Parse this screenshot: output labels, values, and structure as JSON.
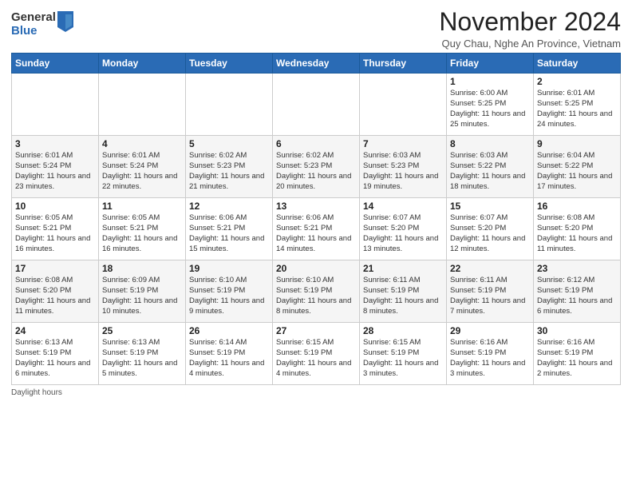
{
  "logo": {
    "general": "General",
    "blue": "Blue"
  },
  "title": "November 2024",
  "location": "Quy Chau, Nghe An Province, Vietnam",
  "days_of_week": [
    "Sunday",
    "Monday",
    "Tuesday",
    "Wednesday",
    "Thursday",
    "Friday",
    "Saturday"
  ],
  "weeks": [
    [
      {
        "day": "",
        "info": ""
      },
      {
        "day": "",
        "info": ""
      },
      {
        "day": "",
        "info": ""
      },
      {
        "day": "",
        "info": ""
      },
      {
        "day": "",
        "info": ""
      },
      {
        "day": "1",
        "info": "Sunrise: 6:00 AM\nSunset: 5:25 PM\nDaylight: 11 hours and 25 minutes."
      },
      {
        "day": "2",
        "info": "Sunrise: 6:01 AM\nSunset: 5:25 PM\nDaylight: 11 hours and 24 minutes."
      }
    ],
    [
      {
        "day": "3",
        "info": "Sunrise: 6:01 AM\nSunset: 5:24 PM\nDaylight: 11 hours and 23 minutes."
      },
      {
        "day": "4",
        "info": "Sunrise: 6:01 AM\nSunset: 5:24 PM\nDaylight: 11 hours and 22 minutes."
      },
      {
        "day": "5",
        "info": "Sunrise: 6:02 AM\nSunset: 5:23 PM\nDaylight: 11 hours and 21 minutes."
      },
      {
        "day": "6",
        "info": "Sunrise: 6:02 AM\nSunset: 5:23 PM\nDaylight: 11 hours and 20 minutes."
      },
      {
        "day": "7",
        "info": "Sunrise: 6:03 AM\nSunset: 5:23 PM\nDaylight: 11 hours and 19 minutes."
      },
      {
        "day": "8",
        "info": "Sunrise: 6:03 AM\nSunset: 5:22 PM\nDaylight: 11 hours and 18 minutes."
      },
      {
        "day": "9",
        "info": "Sunrise: 6:04 AM\nSunset: 5:22 PM\nDaylight: 11 hours and 17 minutes."
      }
    ],
    [
      {
        "day": "10",
        "info": "Sunrise: 6:05 AM\nSunset: 5:21 PM\nDaylight: 11 hours and 16 minutes."
      },
      {
        "day": "11",
        "info": "Sunrise: 6:05 AM\nSunset: 5:21 PM\nDaylight: 11 hours and 16 minutes."
      },
      {
        "day": "12",
        "info": "Sunrise: 6:06 AM\nSunset: 5:21 PM\nDaylight: 11 hours and 15 minutes."
      },
      {
        "day": "13",
        "info": "Sunrise: 6:06 AM\nSunset: 5:21 PM\nDaylight: 11 hours and 14 minutes."
      },
      {
        "day": "14",
        "info": "Sunrise: 6:07 AM\nSunset: 5:20 PM\nDaylight: 11 hours and 13 minutes."
      },
      {
        "day": "15",
        "info": "Sunrise: 6:07 AM\nSunset: 5:20 PM\nDaylight: 11 hours and 12 minutes."
      },
      {
        "day": "16",
        "info": "Sunrise: 6:08 AM\nSunset: 5:20 PM\nDaylight: 11 hours and 11 minutes."
      }
    ],
    [
      {
        "day": "17",
        "info": "Sunrise: 6:08 AM\nSunset: 5:20 PM\nDaylight: 11 hours and 11 minutes."
      },
      {
        "day": "18",
        "info": "Sunrise: 6:09 AM\nSunset: 5:19 PM\nDaylight: 11 hours and 10 minutes."
      },
      {
        "day": "19",
        "info": "Sunrise: 6:10 AM\nSunset: 5:19 PM\nDaylight: 11 hours and 9 minutes."
      },
      {
        "day": "20",
        "info": "Sunrise: 6:10 AM\nSunset: 5:19 PM\nDaylight: 11 hours and 8 minutes."
      },
      {
        "day": "21",
        "info": "Sunrise: 6:11 AM\nSunset: 5:19 PM\nDaylight: 11 hours and 8 minutes."
      },
      {
        "day": "22",
        "info": "Sunrise: 6:11 AM\nSunset: 5:19 PM\nDaylight: 11 hours and 7 minutes."
      },
      {
        "day": "23",
        "info": "Sunrise: 6:12 AM\nSunset: 5:19 PM\nDaylight: 11 hours and 6 minutes."
      }
    ],
    [
      {
        "day": "24",
        "info": "Sunrise: 6:13 AM\nSunset: 5:19 PM\nDaylight: 11 hours and 6 minutes."
      },
      {
        "day": "25",
        "info": "Sunrise: 6:13 AM\nSunset: 5:19 PM\nDaylight: 11 hours and 5 minutes."
      },
      {
        "day": "26",
        "info": "Sunrise: 6:14 AM\nSunset: 5:19 PM\nDaylight: 11 hours and 4 minutes."
      },
      {
        "day": "27",
        "info": "Sunrise: 6:15 AM\nSunset: 5:19 PM\nDaylight: 11 hours and 4 minutes."
      },
      {
        "day": "28",
        "info": "Sunrise: 6:15 AM\nSunset: 5:19 PM\nDaylight: 11 hours and 3 minutes."
      },
      {
        "day": "29",
        "info": "Sunrise: 6:16 AM\nSunset: 5:19 PM\nDaylight: 11 hours and 3 minutes."
      },
      {
        "day": "30",
        "info": "Sunrise: 6:16 AM\nSunset: 5:19 PM\nDaylight: 11 hours and 2 minutes."
      }
    ]
  ],
  "footer": {
    "daylight_label": "Daylight hours"
  }
}
